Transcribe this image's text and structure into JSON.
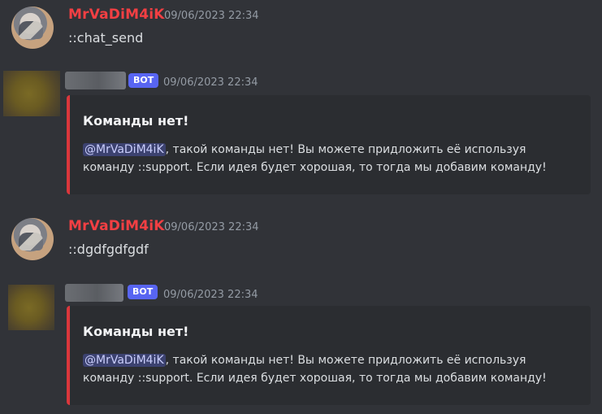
{
  "messages": [
    {
      "username": "MrVaDiM4iK",
      "timestamp": "09/06/2023 22:34",
      "text": "::chat_send"
    },
    {
      "bot_badge": "BOT",
      "timestamp": "09/06/2023 22:34",
      "embed": {
        "title": "Команды нет!",
        "mention": "@MrVaDiM4iK",
        "line1": ", такой команды нет! Вы можете придложить её используя",
        "line2": "команду ::support. Если идея будет хорошая, то тогда мы добавим команду!",
        "accent_color": "#da373c"
      }
    },
    {
      "username": "MrVaDiM4iK",
      "timestamp": "09/06/2023 22:34",
      "text": "::dgdfgdfgdf"
    },
    {
      "bot_badge": "BOT",
      "timestamp": "09/06/2023 22:34",
      "embed": {
        "title": "Команды нет!",
        "mention": "@MrVaDiM4iK",
        "line1": ", такой команды нет! Вы можете придложить её используя",
        "line2": "команду ::support. Если идея будет хорошая, то тогда мы добавим команду!",
        "accent_color": "#da373c"
      }
    }
  ],
  "colors": {
    "background": "#313338",
    "username": "#f23f43",
    "bot_badge": "#5865f2",
    "embed_bg": "#2b2d31"
  }
}
